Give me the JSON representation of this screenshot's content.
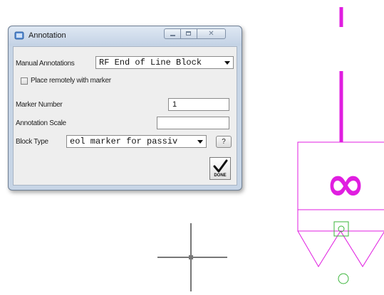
{
  "dialog": {
    "title": "Annotation",
    "fields": {
      "manual_annotations_label": "Manual Annotations",
      "manual_annotations_value": "RF End of Line Block",
      "place_remotely_label": "Place remotely with marker",
      "place_remotely_checked": false,
      "marker_number_label": "Marker Number",
      "marker_number_value": "1",
      "annotation_scale_label": "Annotation Scale",
      "annotation_scale_value": "",
      "block_type_label": "Block Type",
      "block_type_value": "eol marker for passiv"
    },
    "help_label": "?",
    "done_label": "DONE"
  },
  "drawing": {
    "block_symbol": "∞",
    "symbol_color": "#e01ee0",
    "crosshair_color": "#777777",
    "snap_color": "#3ab53a"
  }
}
